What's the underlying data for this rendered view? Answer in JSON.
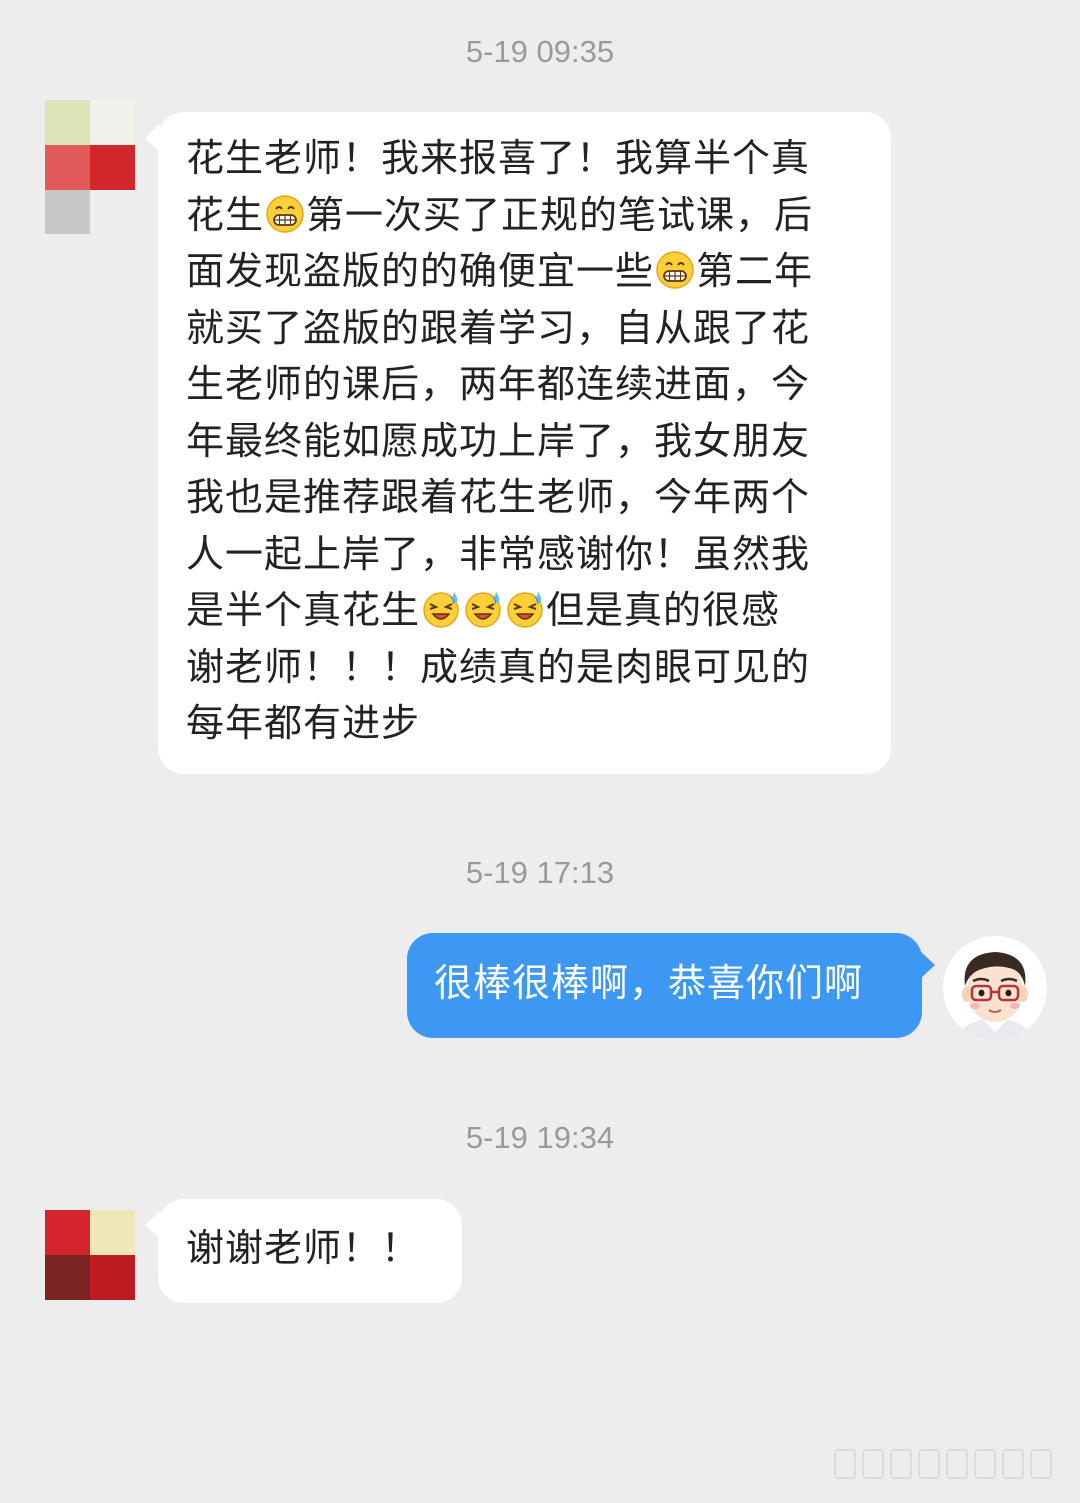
{
  "chat": {
    "timestamps": [
      "5-19 09:35",
      "5-19 17:13",
      "5-19 19:34"
    ],
    "messages": [
      {
        "sender": "student",
        "lines": [
          [
            "花生老师！我来报喜了！我算半个真"
          ],
          [
            "花生",
            ":grin:",
            "第一次买了正规的笔试课，后"
          ],
          [
            "面发现盗版的的确便宜一些",
            ":grin:",
            "第二年"
          ],
          [
            "就买了盗版的跟着学习，自从跟了花"
          ],
          [
            "生老师的课后，两年都连续进面，今"
          ],
          [
            "年最终能如愿成功上岸了，我女朋友"
          ],
          [
            "我也是推荐跟着花生老师，今年两个"
          ],
          [
            "人一起上岸了，非常感谢你！虽然我"
          ],
          [
            "是半个真花生",
            ":cry-laugh:",
            ":cry-laugh:",
            ":cry-laugh:",
            "但是真的很感"
          ],
          [
            "谢老师！！！成绩真的是肉眼可见的"
          ],
          [
            "每年都有进步"
          ]
        ]
      },
      {
        "sender": "teacher",
        "text": "很棒很棒啊，恭喜你们啊"
      },
      {
        "sender": "student",
        "text": "谢谢老师！！"
      }
    ]
  },
  "colors": {
    "background": "#ededed",
    "bubble_received": "#ffffff",
    "bubble_sent": "#3d98f3",
    "timestamp_text": "#9a9a9a"
  },
  "icons": {
    "grin": "grinning-face-emoji",
    "cry_laugh": "sweating-laughing-face-emoji",
    "student_avatar": "pixelated-mosaic-avatar",
    "teacher_avatar": "cartoon-man-with-glasses-avatar"
  }
}
